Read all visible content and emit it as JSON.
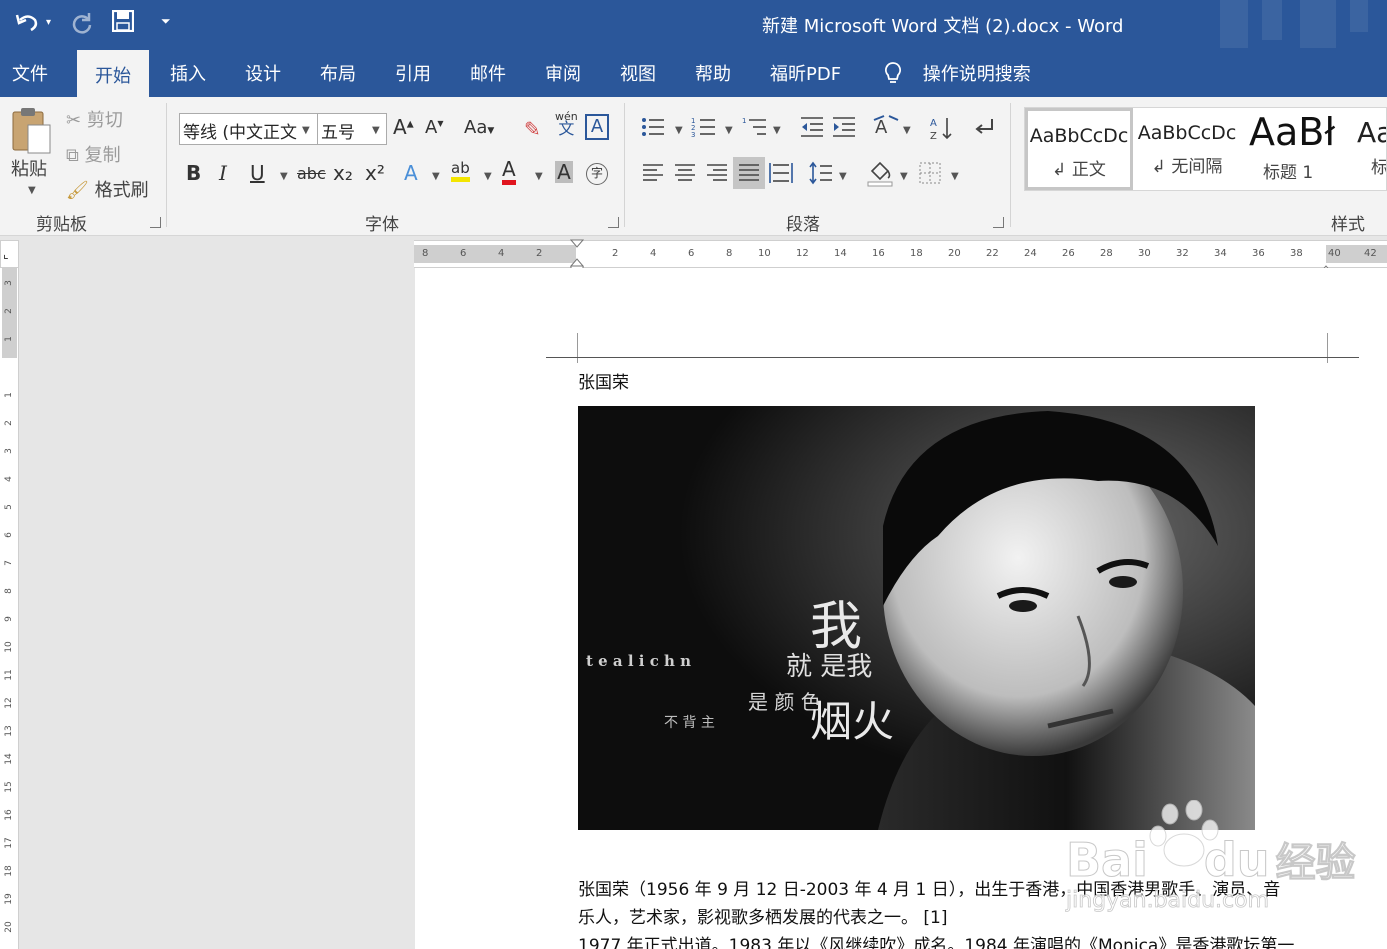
{
  "title_bar": {
    "document_title": "新建 Microsoft Word 文档 (2).docx  -  Word",
    "quick_access": {
      "undo_icon": "undo-icon",
      "redo_icon": "redo-icon",
      "save_icon": "save-icon",
      "customize_icon": "customize-qat-icon"
    }
  },
  "tabs": [
    "文件",
    "开始",
    "插入",
    "设计",
    "布局",
    "引用",
    "邮件",
    "审阅",
    "视图",
    "帮助",
    "福昕PDF"
  ],
  "active_tab": "开始",
  "tell_me": {
    "icon": "lightbulb-icon",
    "label": "操作说明搜索"
  },
  "ribbon": {
    "clipboard": {
      "group_label": "剪贴板",
      "paste": "粘贴",
      "cut": "剪切",
      "copy": "复制",
      "format_painter": "格式刷"
    },
    "font": {
      "group_label": "字体",
      "font_name": "等线 (中文正文",
      "font_size": "五号",
      "change_case": "Aa",
      "pinyin_top": "wén",
      "pinyin_bottom": "文",
      "bold": "B",
      "italic": "I",
      "underline": "U",
      "strikethrough": "abc",
      "subscript": "x₂",
      "superscript": "x²",
      "text_effects": "A",
      "highlight": "ab",
      "font_color": "A",
      "char_shading": "A",
      "enclosed": "字"
    },
    "paragraph": {
      "group_label": "段落"
    },
    "styles": {
      "group_label": "样式",
      "items": [
        {
          "preview": "AaBbCcDc",
          "name": "↲ 正文"
        },
        {
          "preview": "AaBbCcDc",
          "name": "↲ 无间隔"
        },
        {
          "preview": "AaBł",
          "name": "标题 1"
        },
        {
          "preview": "Aa",
          "name": "标"
        }
      ]
    }
  },
  "ruler": {
    "ticks": [
      "8",
      "6",
      "4",
      "2",
      "",
      "2",
      "4",
      "6",
      "8",
      "10",
      "12",
      "14",
      "16",
      "18",
      "20",
      "22",
      "24",
      "26",
      "28",
      "30",
      "32",
      "34",
      "36",
      "38",
      "40",
      "42"
    ]
  },
  "vruler": {
    "ticks": [
      "3",
      "2",
      "1",
      "",
      "1",
      "2",
      "3",
      "4",
      "5",
      "6",
      "7",
      "8",
      "9",
      "10",
      "11",
      "12",
      "13",
      "14",
      "15",
      "16",
      "17",
      "18",
      "19",
      "20"
    ]
  },
  "document": {
    "header_text": "张国荣",
    "photo_overlay": {
      "big1": "我",
      "row1": "就  是我",
      "small_latin": "t e  a l i c h   n",
      "row2": "是 颜 色",
      "big2": "烟火",
      "row3": "不 背 主"
    },
    "paragraph1_line1": "张国荣（1956 年 9 月 12 日-2003 年 4 月 1 日），出生于香港，中国香港男歌手、演员、音",
    "paragraph1_line2": "乐人，艺术家，影视歌多栖发展的代表之一。 [1]",
    "paragraph2_line1": "1977 年正式出道。1983 年以《风继续吹》成名。1984 年演唱的《Monica》是香港歌坛第一",
    "watermark_brand": "Bai",
    "watermark_brand2": "du",
    "watermark_cn": "经验",
    "watermark_url": "jingyan.baidu.com"
  }
}
